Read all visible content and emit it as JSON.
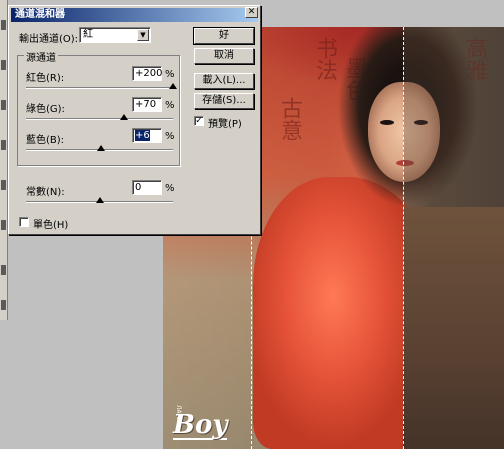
{
  "dialog": {
    "title": "通道混和器",
    "output_channel_label": "輸出通道(O):",
    "output_channel_value": "紅",
    "source_group_title": "源通道",
    "channels": [
      {
        "label": "紅色(R):",
        "value": "+200",
        "unit": "%",
        "slider_fraction": 1.0
      },
      {
        "label": "綠色(G):",
        "value": "+70",
        "unit": "%",
        "slider_fraction": 0.67
      },
      {
        "label": "藍色(B):",
        "value": "+6",
        "unit": "%",
        "slider_fraction": 0.51
      }
    ],
    "constant": {
      "label": "常數(N):",
      "value": "0",
      "unit": "%",
      "slider_fraction": 0.5
    },
    "monochrome_label": "單色(H)",
    "monochrome_checked": false,
    "buttons": {
      "ok": "好",
      "cancel": "取消",
      "load": "載入(L)...",
      "save": "存儲(S)..."
    },
    "preview_label": "預覽(P)",
    "preview_checked": true
  },
  "photo": {
    "watermark": "Boy",
    "watermark_small": "ЛАНА"
  }
}
